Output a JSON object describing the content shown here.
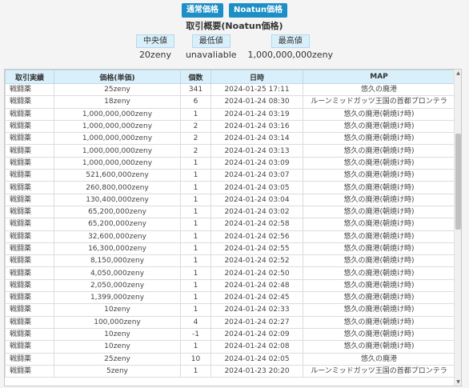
{
  "buttons": {
    "normal_price": "通常価格",
    "noatun_price": "Noatun価格"
  },
  "summary": {
    "title": "取引概要(Noatun価格)",
    "median_label": "中央値",
    "median_value": "20zeny",
    "min_label": "最低値",
    "min_value": "unavaliable",
    "max_label": "最高値",
    "max_value": "1,000,000,000zeny"
  },
  "table": {
    "headers": [
      "取引実績",
      "価格(単価)",
      "個数",
      "日時",
      "MAP"
    ],
    "rows": [
      [
        "戦闘薬",
        "25zeny",
        "341",
        "2024-01-25 17:11",
        "悠久の廃港"
      ],
      [
        "戦闘薬",
        "18zeny",
        "6",
        "2024-01-24 08:30",
        "ルーンミッドガッツ王国の首都プロンテラ"
      ],
      [
        "戦闘薬",
        "1,000,000,000zeny",
        "1",
        "2024-01-24 03:19",
        "悠久の廃港(朝焼け時)"
      ],
      [
        "戦闘薬",
        "1,000,000,000zeny",
        "2",
        "2024-01-24 03:16",
        "悠久の廃港(朝焼け時)"
      ],
      [
        "戦闘薬",
        "1,000,000,000zeny",
        "2",
        "2024-01-24 03:14",
        "悠久の廃港(朝焼け時)"
      ],
      [
        "戦闘薬",
        "1,000,000,000zeny",
        "2",
        "2024-01-24 03:13",
        "悠久の廃港(朝焼け時)"
      ],
      [
        "戦闘薬",
        "1,000,000,000zeny",
        "1",
        "2024-01-24 03:09",
        "悠久の廃港(朝焼け時)"
      ],
      [
        "戦闘薬",
        "521,600,000zeny",
        "1",
        "2024-01-24 03:07",
        "悠久の廃港(朝焼け時)"
      ],
      [
        "戦闘薬",
        "260,800,000zeny",
        "1",
        "2024-01-24 03:05",
        "悠久の廃港(朝焼け時)"
      ],
      [
        "戦闘薬",
        "130,400,000zeny",
        "1",
        "2024-01-24 03:04",
        "悠久の廃港(朝焼け時)"
      ],
      [
        "戦闘薬",
        "65,200,000zeny",
        "1",
        "2024-01-24 03:02",
        "悠久の廃港(朝焼け時)"
      ],
      [
        "戦闘薬",
        "65,200,000zeny",
        "1",
        "2024-01-24 02:58",
        "悠久の廃港(朝焼け時)"
      ],
      [
        "戦闘薬",
        "32,600,000zeny",
        "1",
        "2024-01-24 02:56",
        "悠久の廃港(朝焼け時)"
      ],
      [
        "戦闘薬",
        "16,300,000zeny",
        "1",
        "2024-01-24 02:55",
        "悠久の廃港(朝焼け時)"
      ],
      [
        "戦闘薬",
        "8,150,000zeny",
        "1",
        "2024-01-24 02:52",
        "悠久の廃港(朝焼け時)"
      ],
      [
        "戦闘薬",
        "4,050,000zeny",
        "1",
        "2024-01-24 02:50",
        "悠久の廃港(朝焼け時)"
      ],
      [
        "戦闘薬",
        "2,050,000zeny",
        "1",
        "2024-01-24 02:48",
        "悠久の廃港(朝焼け時)"
      ],
      [
        "戦闘薬",
        "1,399,000zeny",
        "1",
        "2024-01-24 02:45",
        "悠久の廃港(朝焼け時)"
      ],
      [
        "戦闘薬",
        "10zeny",
        "1",
        "2024-01-24 02:33",
        "悠久の廃港(朝焼け時)"
      ],
      [
        "戦闘薬",
        "100,000zeny",
        "4",
        "2024-01-24 02:27",
        "悠久の廃港(朝焼け時)"
      ],
      [
        "戦闘薬",
        "10zeny",
        "-1",
        "2024-01-24 02:09",
        "悠久の廃港(朝焼け時)"
      ],
      [
        "戦闘薬",
        "10zeny",
        "1",
        "2024-01-24 02:08",
        "悠久の廃港(朝焼け時)"
      ],
      [
        "戦闘薬",
        "25zeny",
        "10",
        "2024-01-24 02:05",
        "悠久の廃港"
      ],
      [
        "戦闘薬",
        "5zeny",
        "1",
        "2024-01-23 20:20",
        "ルーンミッドガッツ王国の首都プロンテラ"
      ]
    ]
  },
  "scrollbar": {
    "up_icon": "▲",
    "down_icon": "▼"
  }
}
